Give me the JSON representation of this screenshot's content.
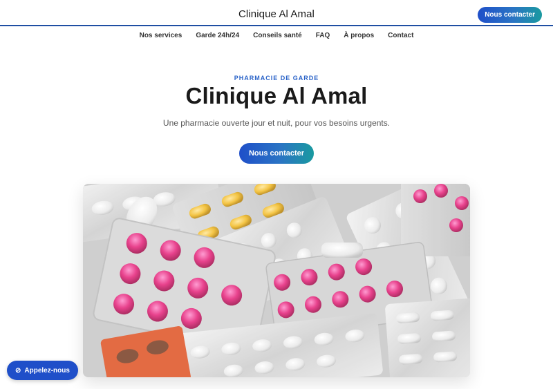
{
  "header": {
    "brand": "Clinique Al Amal",
    "cta_label": "Nous contacter"
  },
  "nav": {
    "items": [
      {
        "label": "Nos services"
      },
      {
        "label": "Garde 24h/24"
      },
      {
        "label": "Conseils santé"
      },
      {
        "label": "FAQ"
      },
      {
        "label": "À propos"
      },
      {
        "label": "Contact"
      }
    ]
  },
  "hero": {
    "eyebrow": "PHARMACIE DE GARDE",
    "title": "Clinique Al Amal",
    "subtitle": "Une pharmacie ouverte jour et nuit, pour vos besoins urgents.",
    "cta_label": "Nous contacter",
    "image_subject": "blister packs of pink, yellow and white pills"
  },
  "floating": {
    "call_label": "Appelez-nous",
    "call_icon": "phone-slash-icon"
  },
  "colors": {
    "accent_blue": "#1f4fc9",
    "accent_teal": "#1a9aa0",
    "eyebrow": "#2a63c8"
  }
}
